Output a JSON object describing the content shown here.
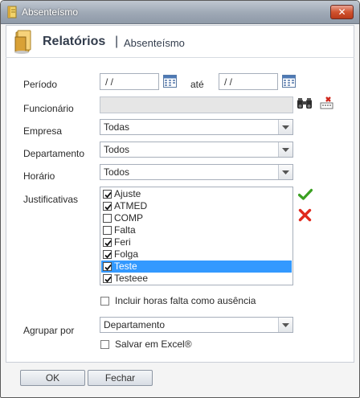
{
  "window": {
    "title": "Absenteísmo",
    "close_glyph": "✕"
  },
  "header": {
    "title": "Relatórios",
    "separator": "|",
    "subtitle": "Absenteísmo"
  },
  "form": {
    "periodo_label": "Período",
    "date_from": "/ /",
    "ate_label": "até",
    "date_to": "/ /",
    "funcionario_label": "Funcionário",
    "funcionario_value": "",
    "empresa_label": "Empresa",
    "empresa_value": "Todas",
    "departamento_label": "Departamento",
    "departamento_value": "Todos",
    "horario_label": "Horário",
    "horario_value": "Todos",
    "justificativas_label": "Justificativas",
    "justificativas": [
      {
        "label": "Ajuste",
        "checked": true,
        "selected": false
      },
      {
        "label": "ATMED",
        "checked": true,
        "selected": false
      },
      {
        "label": "COMP",
        "checked": false,
        "selected": false
      },
      {
        "label": "Falta",
        "checked": false,
        "selected": false
      },
      {
        "label": "Feri",
        "checked": true,
        "selected": false
      },
      {
        "label": "Folga",
        "checked": true,
        "selected": false
      },
      {
        "label": "Teste",
        "checked": true,
        "selected": true
      },
      {
        "label": "Testeee",
        "checked": true,
        "selected": false
      }
    ],
    "incluir_label": "Incluir horas falta como ausência",
    "agrupar_label": "Agrupar por",
    "agrupar_value": "Departamento",
    "salvar_excel_label": "Salvar em Excel®"
  },
  "buttons": {
    "ok": "OK",
    "fechar": "Fechar"
  },
  "icons": {
    "app": "notebook-icon",
    "header": "folder-icon",
    "calendar": "calendar-icon",
    "search": "binoculars-icon",
    "clear": "clear-field-icon",
    "check_all": "green-check-icon",
    "uncheck_all": "red-x-icon"
  },
  "colors": {
    "selection": "#3399ff",
    "check_green": "#3aa021",
    "x_red": "#e02a1e"
  }
}
